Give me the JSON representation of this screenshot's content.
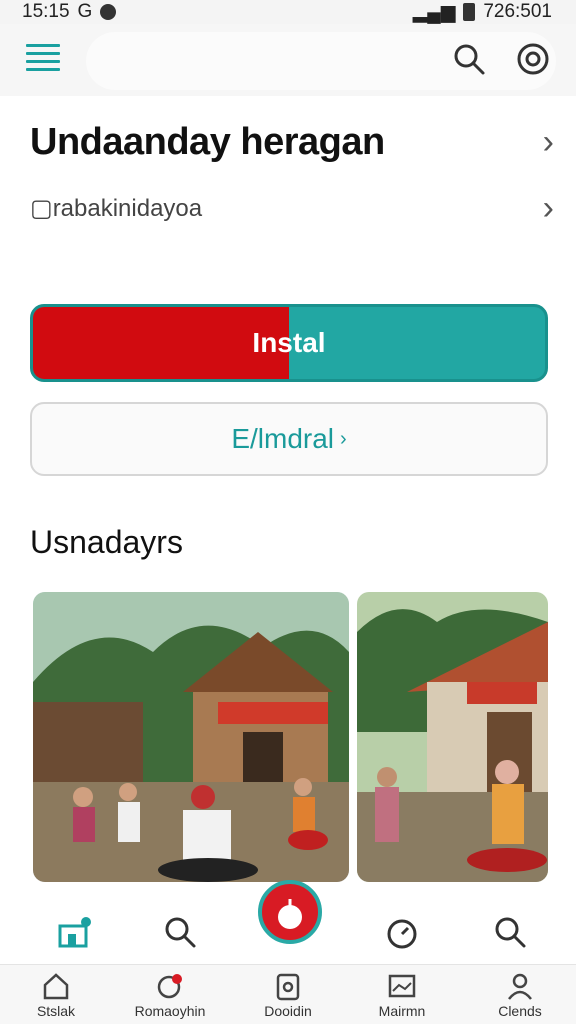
{
  "status_bar": {
    "time": "15:15",
    "left_extra": "G",
    "right_text": "726:501"
  },
  "header": {
    "title": "Undaanday heragan",
    "subtitle": "rabakinidayoa"
  },
  "install": {
    "label": "Instal",
    "progress": 0.5,
    "fill_color": "#d10b10",
    "track_color": "#22a7a3"
  },
  "secondary_button": {
    "label": "E/lmdral"
  },
  "section": {
    "title": "Usnadayrs"
  },
  "bottom_nav": {
    "items": [
      {
        "label": "Stslak",
        "icon": "home-icon"
      },
      {
        "label": "Romaoyhin",
        "icon": "notifications-icon"
      },
      {
        "label": "Dooidin",
        "icon": "device-icon"
      },
      {
        "label": "Mairmn",
        "icon": "gallery-icon"
      },
      {
        "label": "Clends",
        "icon": "profile-icon"
      }
    ]
  },
  "colors": {
    "accent": "#22a7a3",
    "brand_red": "#d10b10"
  }
}
